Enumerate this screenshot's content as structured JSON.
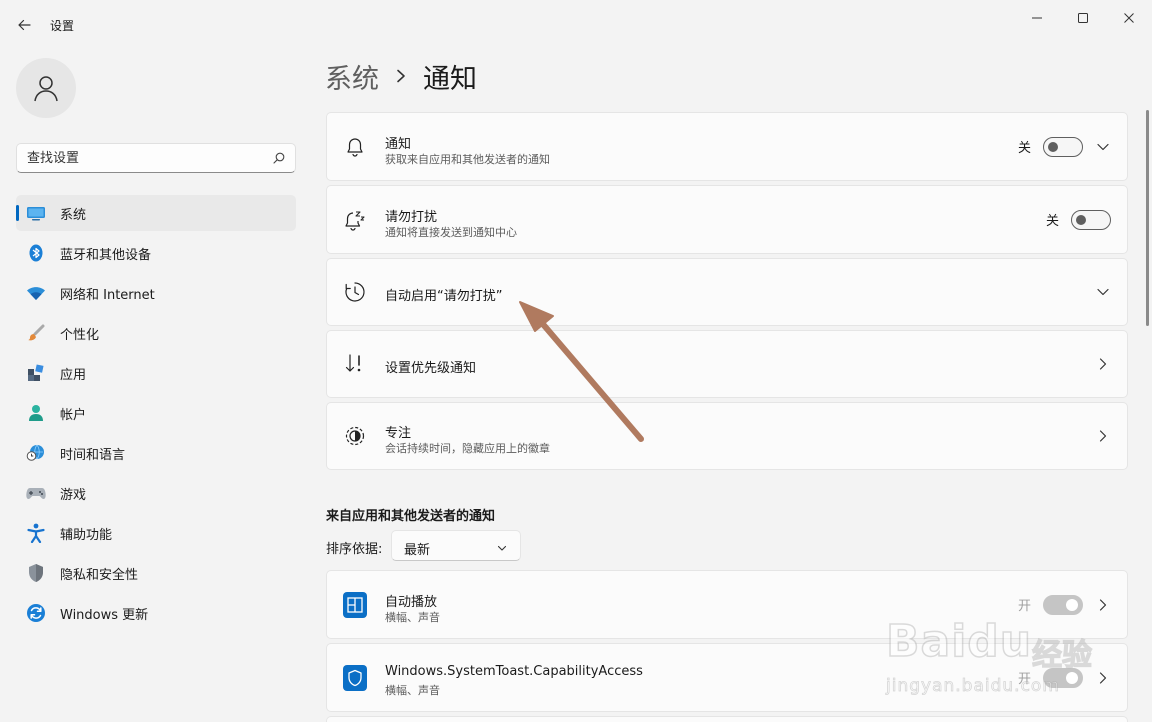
{
  "window": {
    "title": "设置"
  },
  "search": {
    "placeholder": "查找设置"
  },
  "sidebar": {
    "items": [
      {
        "label": "系统",
        "icon": "monitor-icon",
        "active": true
      },
      {
        "label": "蓝牙和其他设备",
        "icon": "bluetooth-icon"
      },
      {
        "label": "网络和 Internet",
        "icon": "wifi-icon"
      },
      {
        "label": "个性化",
        "icon": "brush-icon"
      },
      {
        "label": "应用",
        "icon": "apps-icon"
      },
      {
        "label": "帐户",
        "icon": "person-icon"
      },
      {
        "label": "时间和语言",
        "icon": "globe-clock-icon"
      },
      {
        "label": "游戏",
        "icon": "gamepad-icon"
      },
      {
        "label": "辅助功能",
        "icon": "accessibility-icon"
      },
      {
        "label": "隐私和安全性",
        "icon": "shield-icon"
      },
      {
        "label": "Windows 更新",
        "icon": "update-icon"
      }
    ]
  },
  "breadcrumb": {
    "parent": "系统",
    "current": "通知"
  },
  "cards": {
    "notifications": {
      "title": "通知",
      "subtitle": "获取来自应用和其他发送者的通知",
      "state": "关",
      "icon": "bell-icon"
    },
    "dnd": {
      "title": "请勿打扰",
      "subtitle": "通知将直接发送到通知中心",
      "state": "关",
      "icon": "bell-zzz-icon"
    },
    "auto_dnd": {
      "title": "自动启用“请勿打扰”",
      "icon": "clock-icon"
    },
    "priority": {
      "title": "设置优先级通知",
      "icon": "sort-arrows-icon"
    },
    "focus": {
      "title": "专注",
      "subtitle": "会话持续时间，隐藏应用上的徽章",
      "icon": "focus-icon"
    }
  },
  "apps_section": {
    "title": "来自应用和其他发送者的通知",
    "sort_label": "排序依据:",
    "sort_value": "最新",
    "apps": [
      {
        "title": "自动播放",
        "subtitle": "横幅、声音",
        "state": "开",
        "icon": "autoplay-icon"
      },
      {
        "title": "Windows.SystemToast.CapabilityAccess",
        "subtitle": "横幅、声音",
        "state": "开",
        "icon": "shield-app-icon"
      }
    ]
  },
  "watermark": {
    "logo": "Baidu",
    "cn": "经验",
    "url": "jingyan.baidu.com"
  },
  "colors": {
    "accent": "#0067c0",
    "annotation_arrow": "#b07a5f"
  }
}
